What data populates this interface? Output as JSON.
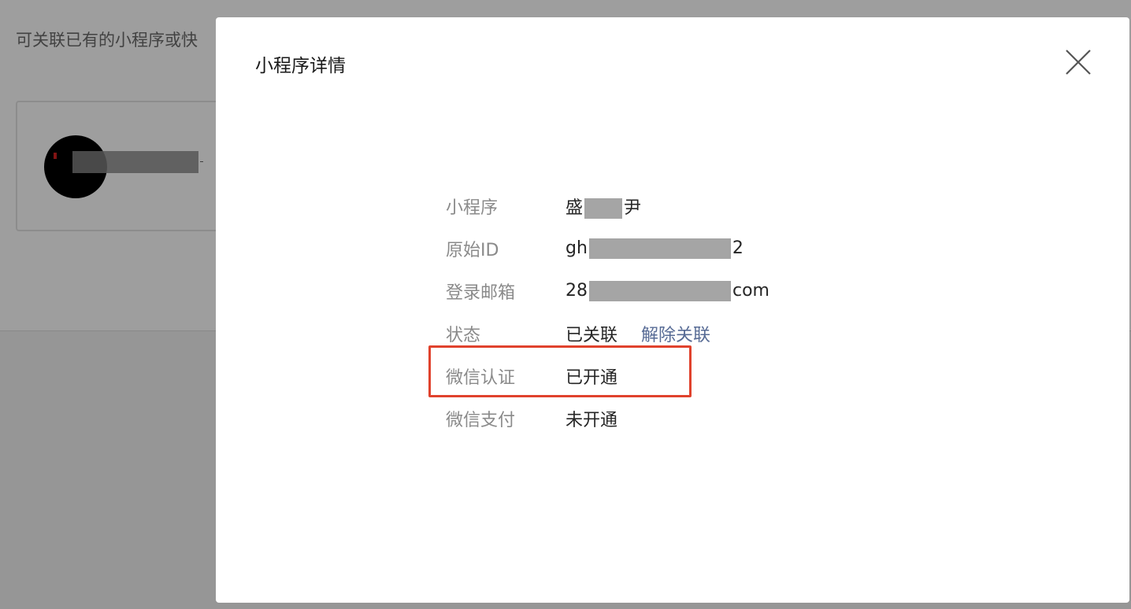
{
  "background": {
    "hint_text": "可关联已有的小程序或快"
  },
  "dialog": {
    "title": "小程序详情",
    "close_icon": "close-icon",
    "rows": [
      {
        "label": "小程序",
        "value_prefix": "盛",
        "value_suffix": "尹"
      },
      {
        "label": "原始ID",
        "value_prefix": "gh",
        "value_suffix": "2"
      },
      {
        "label": "登录邮箱",
        "value_prefix": "28",
        "value_suffix": "com"
      },
      {
        "label": "状态",
        "value": "已关联",
        "action": "解除关联"
      },
      {
        "label": "微信认证",
        "value": "已开通"
      },
      {
        "label": "微信支付",
        "value": "未开通"
      }
    ]
  },
  "colors": {
    "link": "#576b95",
    "highlight": "#e0422d",
    "label": "#8a8a8a",
    "value": "#262626"
  }
}
